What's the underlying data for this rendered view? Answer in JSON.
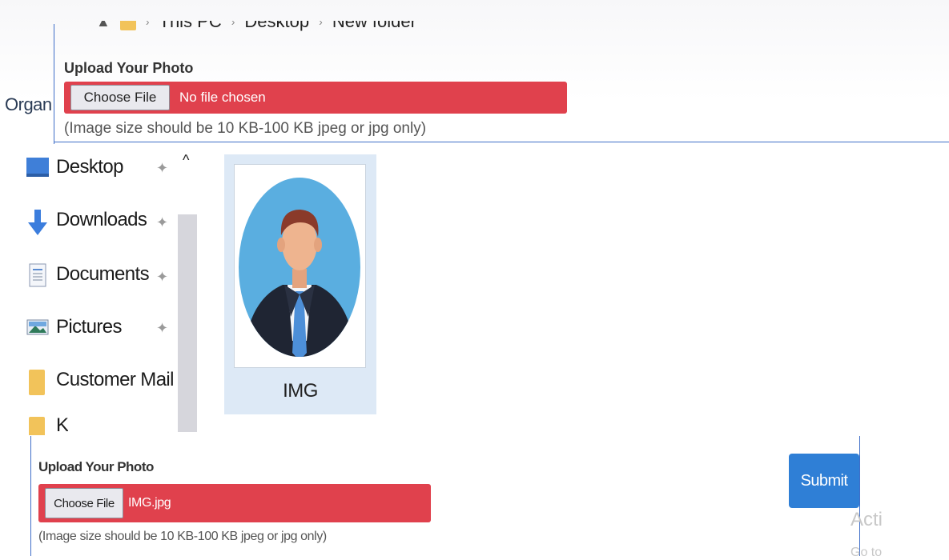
{
  "explorer": {
    "breadcrumb": [
      "This PC",
      "Desktop",
      "New folder"
    ],
    "organize_label": "Organ",
    "nav_items": [
      {
        "label": "Desktop",
        "icon": "desktop-icon",
        "pinned": true
      },
      {
        "label": "Downloads",
        "icon": "download-arrow-icon",
        "pinned": true
      },
      {
        "label": "Documents",
        "icon": "document-icon",
        "pinned": true
      },
      {
        "label": "Pictures",
        "icon": "pictures-icon",
        "pinned": true
      },
      {
        "label": "Customer Mail A",
        "icon": "folder-icon",
        "pinned": false
      },
      {
        "label": "K",
        "icon": "folder-icon",
        "pinned": false
      }
    ],
    "file": {
      "name": "IMG",
      "icon": "person-avatar-icon"
    }
  },
  "upload_top": {
    "title": "Upload Your Photo",
    "choose_label": "Choose File",
    "status": "No file chosen",
    "hint": "(Image size should be 10 KB-100 KB jpeg or jpg only)"
  },
  "upload_bottom": {
    "title": "Upload Your Photo",
    "choose_label": "Choose File",
    "status": "IMG.jpg",
    "hint": "(Image size should be 10 KB-100 KB jpeg or jpg only)",
    "submit_label": "Submit"
  },
  "watermark": {
    "line1": "Acti",
    "line2": "Go to"
  },
  "colors": {
    "accent_red": "#e0414d",
    "submit_blue": "#2f7fd6",
    "divider_blue": "#3f6ec8"
  }
}
